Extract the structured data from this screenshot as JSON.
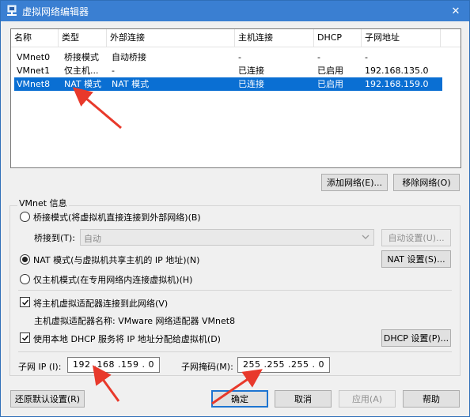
{
  "window": {
    "title": "虚拟网络编辑器",
    "close_symbol": "✕"
  },
  "table": {
    "headers": [
      "名称",
      "类型",
      "外部连接",
      "主机连接",
      "DHCP",
      "子网地址"
    ],
    "rows": [
      [
        "VMnet0",
        "桥接模式",
        "自动桥接",
        "-",
        "-",
        "-"
      ],
      [
        "VMnet1",
        "仅主机...",
        "-",
        "已连接",
        "已启用",
        "192.168.135.0"
      ],
      [
        "VMnet8",
        "NAT 模式",
        "NAT 模式",
        "已连接",
        "已启用",
        "192.168.159.0"
      ]
    ],
    "selected_row": "VMnet8"
  },
  "buttons": {
    "add_network": "添加网络(E)...",
    "remove_network": "移除网络(O)",
    "auto_settings": "自动设置(U)...",
    "nat_settings": "NAT 设置(S)...",
    "dhcp_settings": "DHCP 设置(P)...",
    "restore_defaults": "还原默认设置(R)",
    "ok": "确定",
    "cancel": "取消",
    "apply": "应用(A)",
    "help": "帮助"
  },
  "vmnet_info": {
    "group_label": "VMnet 信息",
    "bridged_mode": "桥接模式(将虚拟机直接连接到外部网络)(B)",
    "bridged_to_label": "桥接到(T):",
    "bridged_to_value": "自动",
    "nat_mode": "NAT 模式(与虚拟机共享主机的 IP 地址)(N)",
    "host_only_mode": "仅主机模式(在专用网络内连接虚拟机)(H)",
    "selected_mode": "nat",
    "connect_host_adapter": "将主机虚拟适配器连接到此网络(V)",
    "connect_host_adapter_checked": true,
    "host_adapter_name": "主机虚拟适配器名称: VMware 网络适配器 VMnet8",
    "use_dhcp": "使用本地 DHCP 服务将 IP 地址分配给虚拟机(D)",
    "use_dhcp_checked": true,
    "subnet_ip_label": "子网 IP (I):",
    "subnet_ip_value": "192 .168 .159 . 0",
    "subnet_mask_label": "子网掩码(M):",
    "subnet_mask_value": "255 .255 .255 . 0"
  },
  "colors": {
    "title_bar": "#3a7fd2",
    "selection": "#0a6fd3",
    "annotation_arrow": "#e8392b"
  }
}
